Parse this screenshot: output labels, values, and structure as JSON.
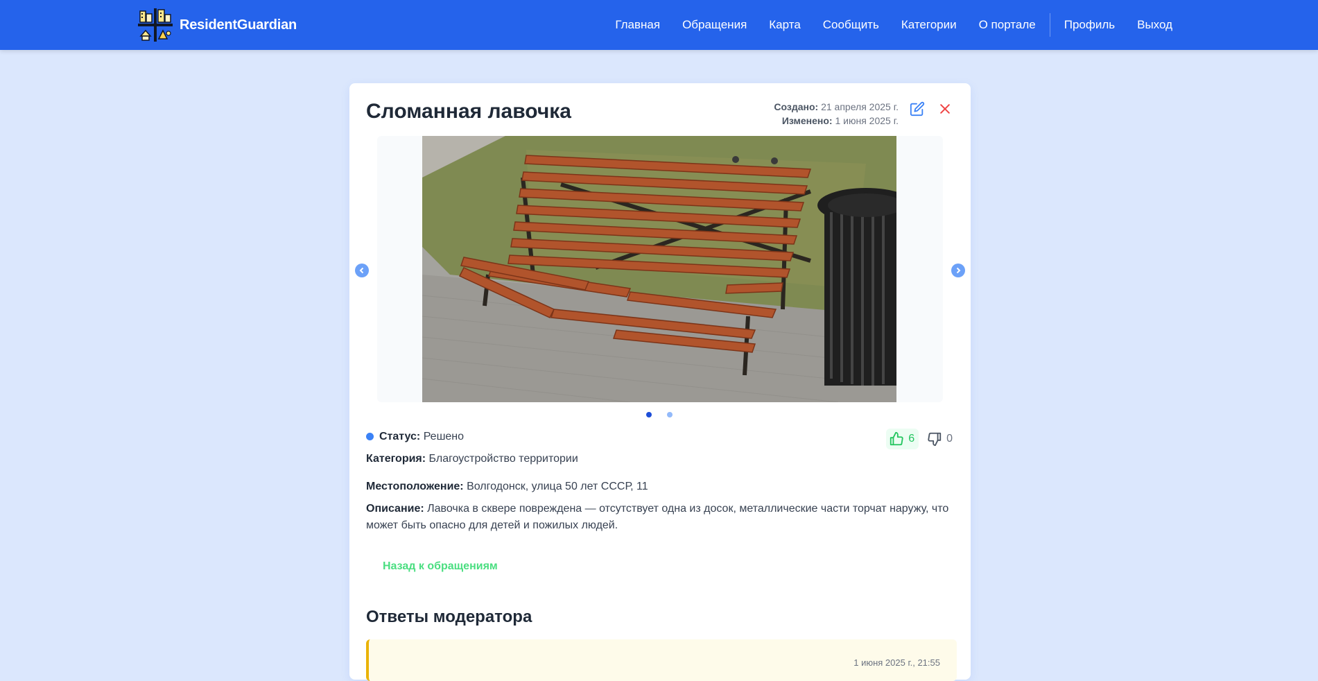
{
  "app": {
    "name": "ResidentGuardian"
  },
  "nav": {
    "items": [
      {
        "label": "Главная"
      },
      {
        "label": "Обращения"
      },
      {
        "label": "Карта"
      },
      {
        "label": "Сообщить"
      },
      {
        "label": "Категории"
      },
      {
        "label": "О портале"
      }
    ],
    "profile": "Профиль",
    "logout": "Выход"
  },
  "issue": {
    "title": "Сломанная лавочка",
    "created_label": "Создано:",
    "created_value": "21 апреля 2025 г.",
    "updated_label": "Изменено:",
    "updated_value": "1 июня 2025 г.",
    "status_label": "Статус:",
    "status_value": "Решено",
    "category_label": "Категория:",
    "category_value": "Благоустройство территории",
    "location_label": "Местоположение:",
    "location_value": "Волгодонск, улица 50 лет СССР, 11",
    "description_label": "Описание:",
    "description_value": "Лавочка в сквере повреждена — отсутствует одна из досок, металлические части торчат наружу, что может быть опасно для детей и пожилых людей.",
    "likes": "6",
    "dislikes": "0",
    "carousel": {
      "slides": 2,
      "active": 1
    }
  },
  "actions": {
    "back": "Назад к обращениям"
  },
  "moderator": {
    "title": "Ответы модератора",
    "first_answer_date": "1 июня 2025 г., 21:55"
  },
  "colors": {
    "nav": "#2563eb",
    "page_bg": "#dbe7fd",
    "status": "#3b82f6",
    "like": "#22c55e",
    "back_link": "#4ade80",
    "answer_accent": "#eab308",
    "close": "#ef4444"
  },
  "icons": {
    "logo": "city-icon",
    "edit": "edit-icon",
    "close": "close-icon",
    "prev": "chevron-left-icon",
    "next": "chevron-right-icon",
    "like": "thumbs-up-icon",
    "dislike": "thumbs-down-icon"
  }
}
